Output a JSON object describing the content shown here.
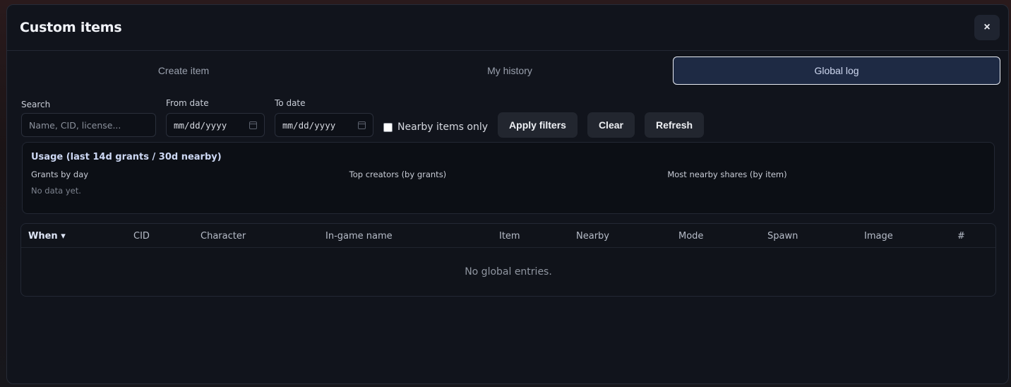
{
  "modal": {
    "title": "Custom items",
    "close_label": "×"
  },
  "tabs": [
    {
      "label": "Create item",
      "active": false
    },
    {
      "label": "My history",
      "active": false
    },
    {
      "label": "Global log",
      "active": true
    }
  ],
  "filters": {
    "search_label": "Search",
    "search_placeholder": "Name, CID, license...",
    "from_label": "From date",
    "from_value": "mm/dd/yyyy",
    "to_label": "To date",
    "to_value": "mm/dd/yyyy",
    "nearby_label": "Nearby items only",
    "nearby_checked": false,
    "apply_label": "Apply filters",
    "clear_label": "Clear",
    "refresh_label": "Refresh"
  },
  "usage": {
    "title": "Usage (last 14d grants / 30d nearby)",
    "grants_by_day": "Grants by day",
    "grants_empty": "No data yet.",
    "top_creators": "Top creators (by grants)",
    "most_nearby": "Most nearby shares (by item)"
  },
  "table": {
    "columns": [
      "When ▾",
      "CID",
      "Character",
      "In-game name",
      "Item",
      "Nearby",
      "Mode",
      "Spawn",
      "Image",
      "#"
    ],
    "sorted_column": "When ▾",
    "empty_text": "No global entries."
  },
  "colors": {
    "accent": "#1e2a44",
    "modal_bg": "#11141c"
  }
}
